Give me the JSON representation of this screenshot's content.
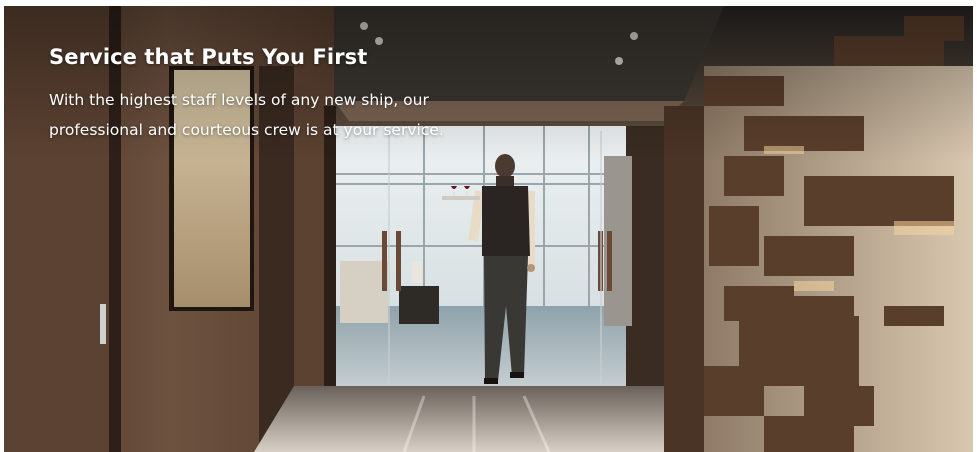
{
  "hero": {
    "title": "Service that Puts You First",
    "description": "With the highest staff levels of any new ship, our professional and courteous crew is at your service.",
    "image_subject": "cruise-steward-carrying-wine-tray"
  },
  "colors": {
    "title_text": "#ffffff",
    "body_text": "#ffffff",
    "wood_dark": "#3a2a20",
    "wood_mid": "#6a4e3a",
    "stone_light": "#c9b8a0",
    "floor_marble": "#b9c4c8"
  }
}
